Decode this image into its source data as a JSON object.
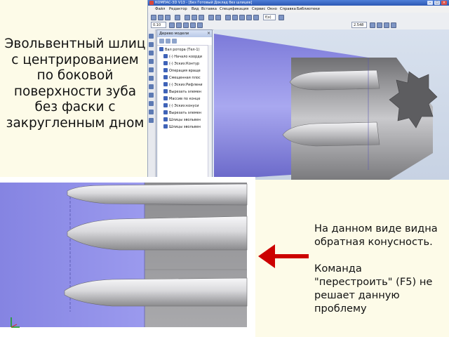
{
  "slide": {
    "title_lines": [
      "Эвольвентный шлиц",
      "с центрированием",
      "по боковой",
      "поверхности зуба",
      "без фаски с",
      "закругленным дном"
    ],
    "note_para1": [
      "На данном виде видна",
      "обратная конусность."
    ],
    "note_para2": [
      "Команда",
      "\"перестроить\" (F5) не",
      "решает данную",
      "проблему"
    ]
  },
  "app": {
    "title": "КОМПАС-3D V13 - [Без Готовый Доклад без шлицев]",
    "menu": [
      "Файл",
      "Редактор",
      "Вид",
      "Вставка",
      "Спецификация",
      "Сервис",
      "Окно",
      "Справка",
      "Библиотеки"
    ],
    "toolbar": {
      "zoom_value": "2.548",
      "scale_value": "0.10",
      "fx_label": "f(x)"
    },
    "tree": {
      "header": "Дерево модели",
      "items": [
        "Вал ротора (Тел-1)",
        "(-) Начало коорди",
        "(-) Эскиз:Контур",
        "Операция враще",
        "Смещенная плос",
        "(-) Эскиз:Рифлени",
        "Вырезать элемен",
        "Массив по конце",
        "(-) Эскиз:конуси",
        "Вырезать элемен",
        "Шлицы эвольвен",
        "Шлицы эвольвен"
      ]
    }
  },
  "colors": {
    "slide_bg": "#fdfbe8",
    "arrow": "#cc0000",
    "shaft_blue": "#8a88e6",
    "model_grey": "#9a9a9c"
  },
  "icons": [
    "app-icon",
    "minimize-icon",
    "maximize-icon",
    "close-icon",
    "red-arrow-icon",
    "axis-triad-icon"
  ]
}
